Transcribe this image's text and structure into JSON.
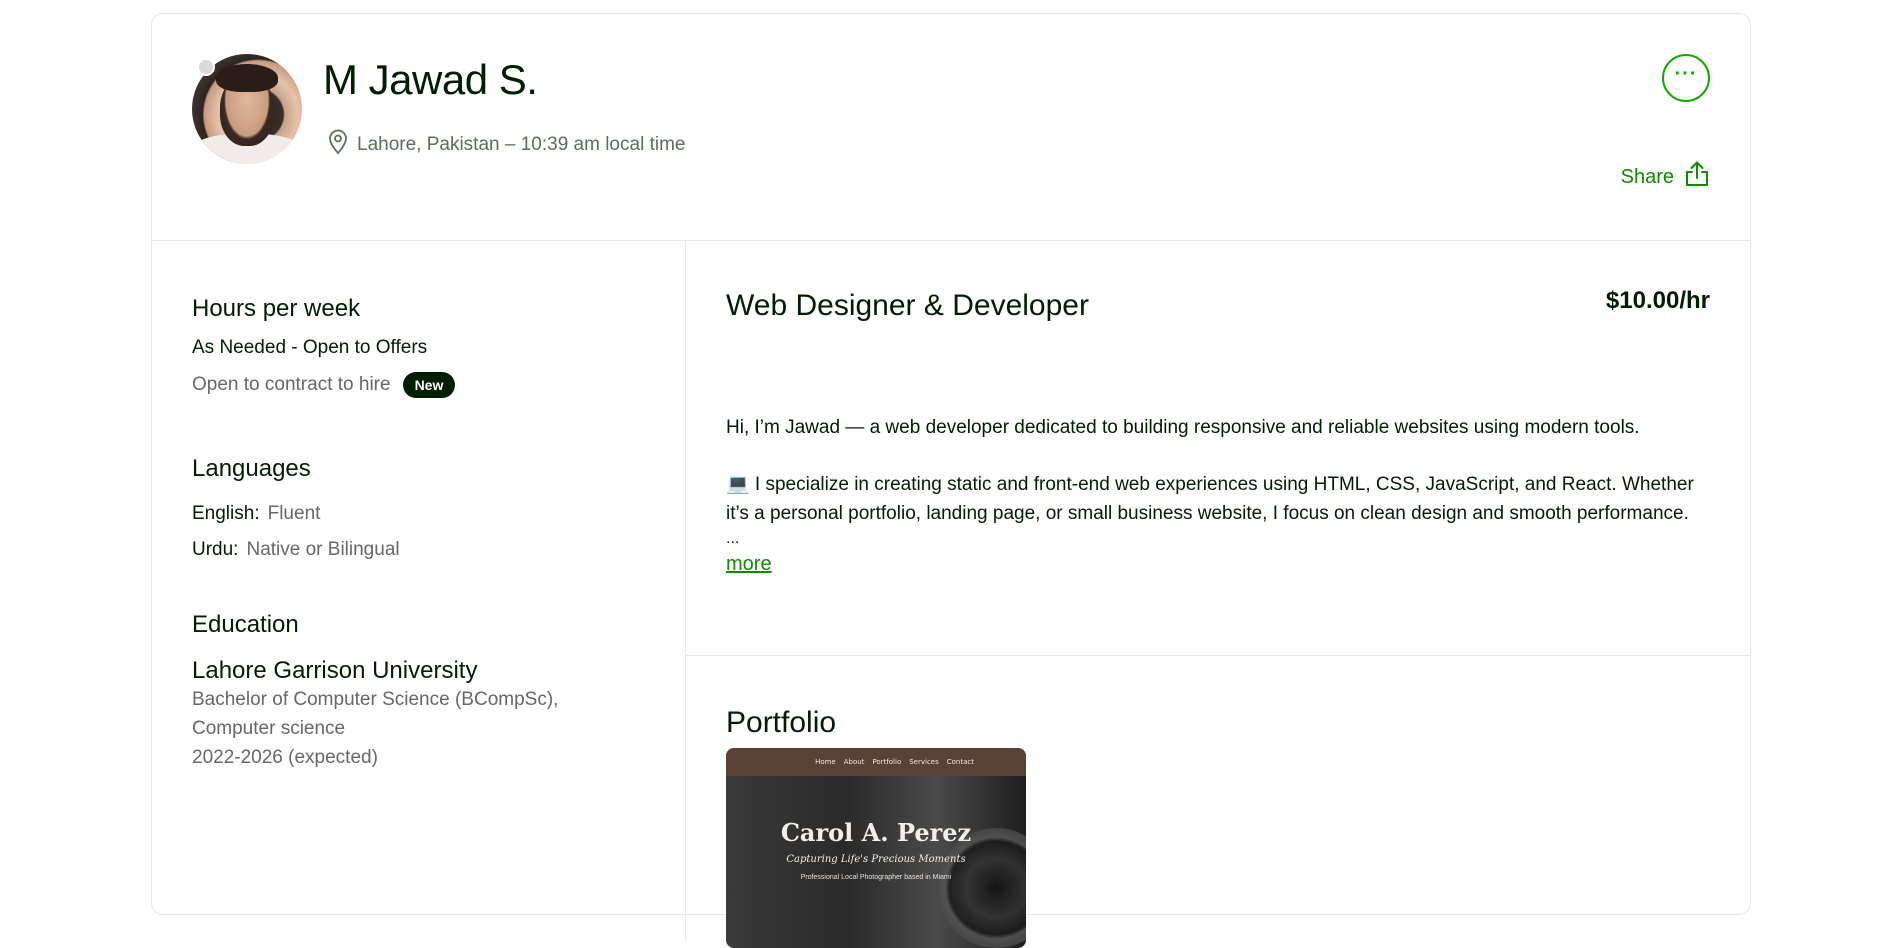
{
  "profile": {
    "name": "M Jawad S.",
    "location": "Lahore, Pakistan – 10:39 am local time",
    "more_icon": "ellipsis-icon",
    "share_label": "Share"
  },
  "availability": {
    "heading": "Hours per week",
    "hours": "As Needed - Open to Offers",
    "contract": "Open to contract to hire",
    "badge": "New"
  },
  "languages": {
    "heading": "Languages",
    "items": [
      {
        "name": "English:",
        "level": "Fluent"
      },
      {
        "name": "Urdu:",
        "level": "Native or Bilingual"
      }
    ]
  },
  "education": {
    "heading": "Education",
    "school": "Lahore Garrison University",
    "degree_line1": "Bachelor of Computer Science (BCompSc),",
    "degree_line2": "Computer science",
    "years": "2022-2026 (expected)"
  },
  "overview": {
    "title": "Web Designer & Developer",
    "rate": "$10.00/hr",
    "bio_p1": "Hi, I’m Jawad — a web developer dedicated to building responsive and reliable websites using modern tools.",
    "bio_p2": "💻 I specialize in creating static and front-end web experiences using HTML, CSS, JavaScript, and React. Whether it’s a personal portfolio, landing page, or small business website, I focus on clean design and smooth performance.",
    "ellipsis": "...",
    "more_label": "more"
  },
  "portfolio": {
    "heading": "Portfolio",
    "item": {
      "nav": [
        "Home",
        "About",
        "Portfolio",
        "Services",
        "Contact"
      ],
      "title": "Carol A. Perez",
      "subtitle": "Capturing Life's Precious Moments",
      "tagline": "Professional Local Photographer based in Miami"
    }
  },
  "colors": {
    "accent_green": "#14a800",
    "link_green": "#108a00",
    "text_dark": "#001e00",
    "text_muted": "#676767",
    "border": "#e4ebe4"
  }
}
